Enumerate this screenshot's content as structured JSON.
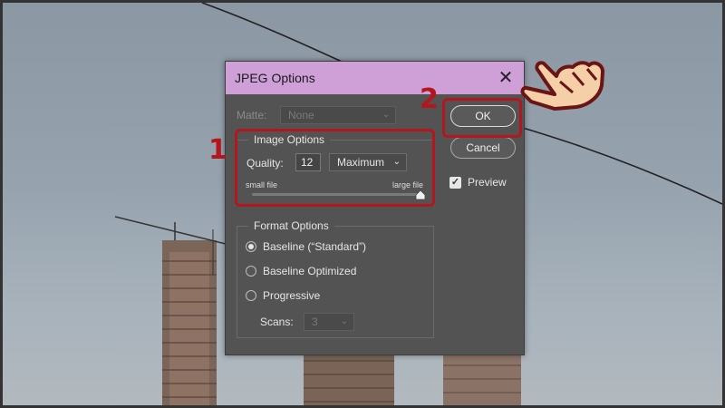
{
  "dialog": {
    "title": "JPEG Options",
    "close_glyph": "✕",
    "matte": {
      "label": "Matte:",
      "value": "None"
    },
    "image_options": {
      "title": "Image Options",
      "quality_label": "Quality:",
      "quality_value": "12",
      "quality_preset": "Maximum",
      "small_file": "small file",
      "large_file": "large file",
      "slider_level": 1.0
    },
    "format_options": {
      "title": "Format Options",
      "baseline_standard": "Baseline (“Standard”)",
      "baseline_optimized": "Baseline Optimized",
      "progressive": "Progressive",
      "scans_label": "Scans:",
      "scans_value": "3",
      "selected": "baseline_standard"
    },
    "ok_label": "OK",
    "cancel_label": "Cancel",
    "preview_label": "Preview",
    "preview_checked": true
  },
  "annotations": {
    "step1": "1",
    "step2": "2",
    "color": "#b3161d"
  },
  "icons": {
    "close": "close-icon",
    "chevron": "chevron-down-icon",
    "hand": "pointing-hand-icon",
    "check": "checkmark-icon"
  }
}
